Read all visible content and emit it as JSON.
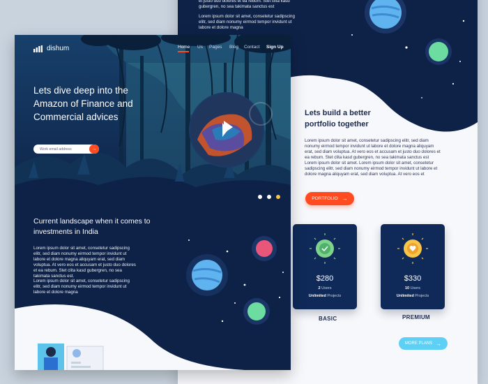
{
  "back_page": {
    "top_lorem_1": "et justo duo dolores et ea rebum. Stet clita kasd gubergren, no sea takimata sanctus est",
    "top_lorem_2": "Lorem ipsum dolor sit amet, consetetur sadipscing elitr, sed diam nonumy eirmod tempor invidunt ut labore et dolore magna",
    "heading": "Lets build a better portfolio together",
    "paragraph": "Lorem ipsum dolor sit amet, consetetur sadipscing elitr, sed diam nonumy eirmod tempor invidunt ut labore et dolore magna aliquyam erat, sed diam voluptua. At vero eos et accusam et justo duo dolores et ea rebum. Stet clita kasd gubergren, no sea takimata sanctus est Lorem ipsum dolor sit amet. Lorem ipsum dolor sit amet, consetetur sadipscing elitr, sed diam nonumy eirmod tempor invidunt ut labore et dolore magna aliquyam erat, sed diam voluptua. At vero eos et",
    "portfolio_button": "PORTFOLIO",
    "plans": [
      {
        "price": "$280",
        "users_num": "2",
        "users_label": "Users",
        "projects_num": "Unlimited",
        "projects_label": "Projects",
        "name": "BASIC",
        "badge_color": "#7fd38c"
      },
      {
        "price": "$330",
        "users_num": "10",
        "users_label": "Users",
        "projects_num": "Unlimited",
        "projects_label": "Projects",
        "name": "PREMIUM",
        "badge_color": "#f6c54a"
      }
    ],
    "more_plans_button": "MORE PLANS"
  },
  "front_page": {
    "logo_text": "dishum",
    "nav": [
      "Home",
      "Us",
      "Pages",
      "Blog",
      "Contact"
    ],
    "signup": "Sign Up",
    "hero_title": "Lets dive deep into the Amazon of Finance and Commercial advices",
    "email_placeholder": "Work email address",
    "section_title": "Current landscape when it comes to investments in India",
    "para_1": "Lorem ipsum dolor sit amet, consetetur sadipscing elitr, sed diam nonumy eirmod tempor invidunt ut labore et dolore magna aliquyam erat, sed diam voluptua. At vero eos et accusam et justo duo dolores et ea rebum. Stet clita kasd gubergren, no sea takimata sanctus est.",
    "para_2": "Lorem ipsum dolor sit amet, consetetur sadipscing elitr, sed diam nonumy eirmod tempor invidunt ut labore et dolore magna"
  },
  "colors": {
    "navy": "#0e2248",
    "accent": "#ff4b1f",
    "cyan_button": "#5ed0f5",
    "page_bg": "#c9d3de"
  }
}
